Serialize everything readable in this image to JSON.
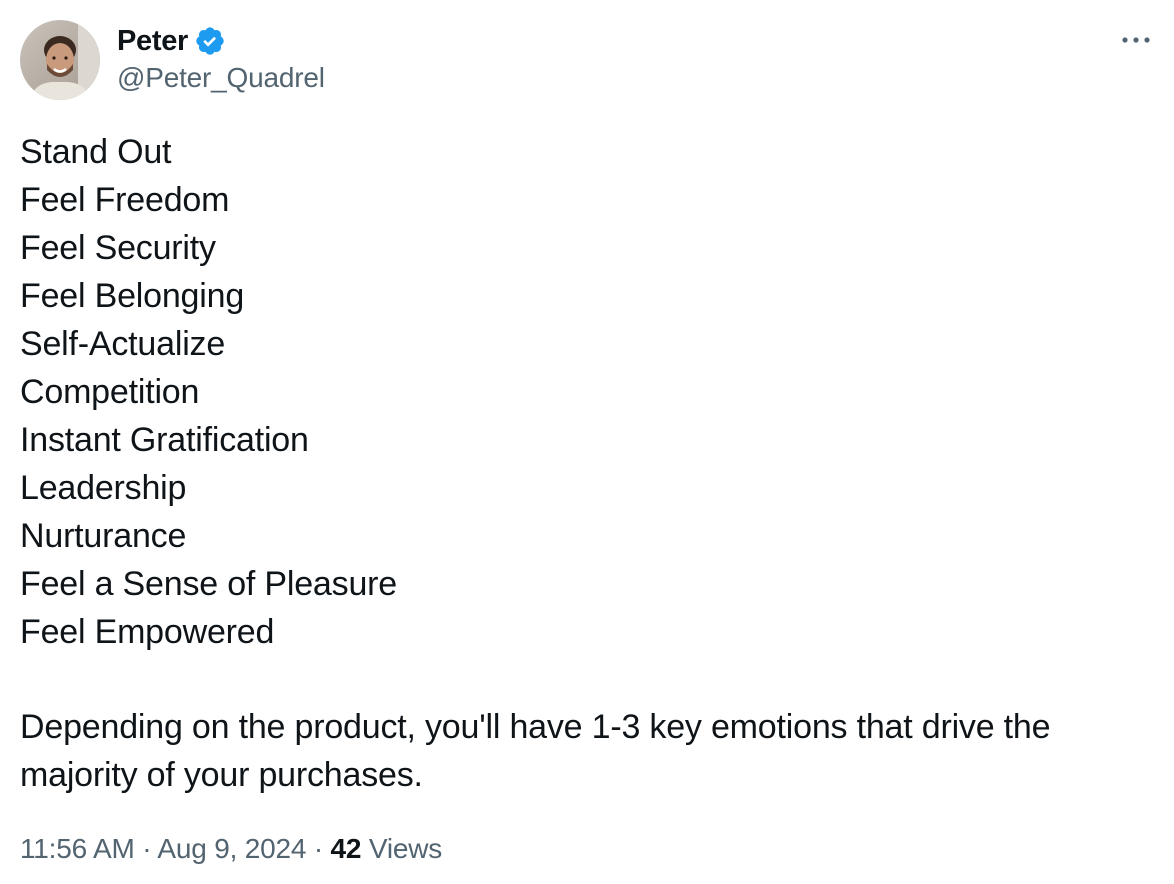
{
  "author": {
    "display_name": "Peter",
    "handle": "@Peter_Quadrel",
    "verified_icon": "verified-badge-icon",
    "avatar": "profile-photo"
  },
  "more_icon": "more-horizontal-icon",
  "body": {
    "lines": [
      "Stand Out",
      "Feel Freedom",
      "Feel Security",
      "Feel Belonging",
      "Self-Actualize",
      "Competition",
      "Instant Gratification",
      "Leadership",
      "Nurturance",
      "Feel a Sense of Pleasure",
      "Feel Empowered"
    ],
    "summary": "Depending on the product, you'll have 1-3 key emotions that drive the majority of your purchases."
  },
  "meta": {
    "time": "11:56 AM",
    "separator": "·",
    "date": "Aug 9, 2024",
    "views_count": "42",
    "views_label": "Views"
  },
  "colors": {
    "text": "#0f1419",
    "secondary": "#536471",
    "verified": "#1d9bf0"
  }
}
